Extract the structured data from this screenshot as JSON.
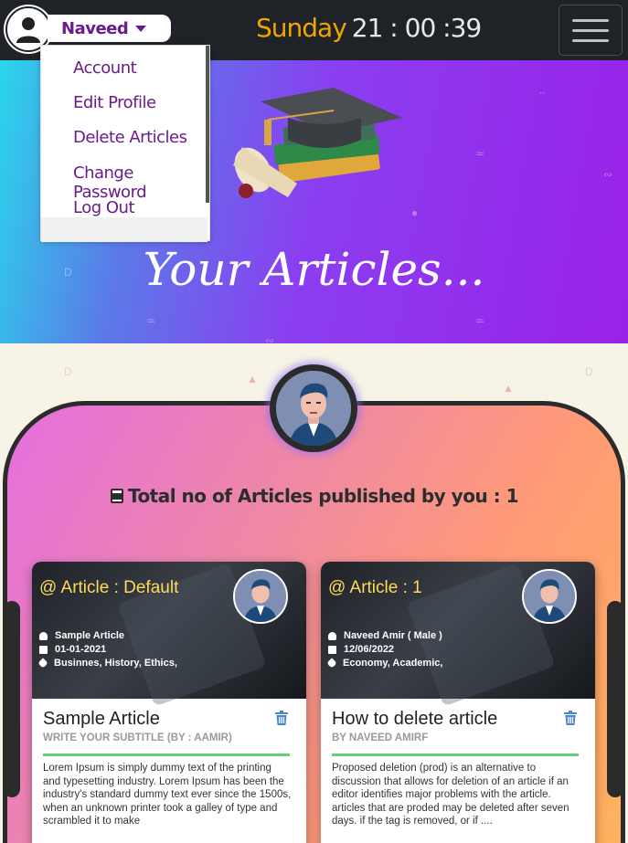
{
  "header": {
    "user_name": "Naveed",
    "day": "Sunday",
    "time": "21 : 00 :39"
  },
  "dropdown": {
    "items": [
      "Account",
      "Edit Profile",
      "Delete Articles",
      "Change Password",
      "Log Out"
    ]
  },
  "hero": {
    "title": "Your Articles..."
  },
  "summary": {
    "total_label": "Total no of Articles published by you : 1"
  },
  "cards": [
    {
      "label": "@ Article : Default",
      "author": "Sample Article",
      "date": "01-01-2021",
      "tags": "Businnes, History, Ethics,",
      "title": "Sample Article",
      "subtitle": "WRITE YOUR SUBTITLE (BY : AAMIR)",
      "body": "Lorem Ipsum is simply dummy text of the printing and typesetting industry. Lorem Ipsum has been the industry's standard dummy text ever since the 1500s, when an unknown printer took a galley of type and scrambled it to make"
    },
    {
      "label": "@ Article : 1",
      "author": "Naveed Amir ( Male )",
      "date": "12/06/2022",
      "tags": "Economy, Academic,",
      "title": "How to delete article",
      "subtitle": "BY NAVEED AMIRF",
      "body": "Proposed deletion (prod) is an alternative to discussion that allows for deletion of an article if an editor identifies major problems with the article. articles that are proded may be deleted after seven days. if the tag is removed, or if ...."
    }
  ],
  "colors": {
    "topbar": "#1f2226",
    "accent_purple": "#6a1b8c",
    "day_orange": "#f0a500",
    "card_label": "#ffd95a",
    "rule_green": "#5dd27a"
  },
  "icons": [
    "user-avatar-icon",
    "caret-down-icon",
    "hamburger-menu-icon",
    "graduation-cap-icon",
    "book-icon",
    "user-icon",
    "calendar-icon",
    "tag-icon",
    "trash-icon"
  ]
}
